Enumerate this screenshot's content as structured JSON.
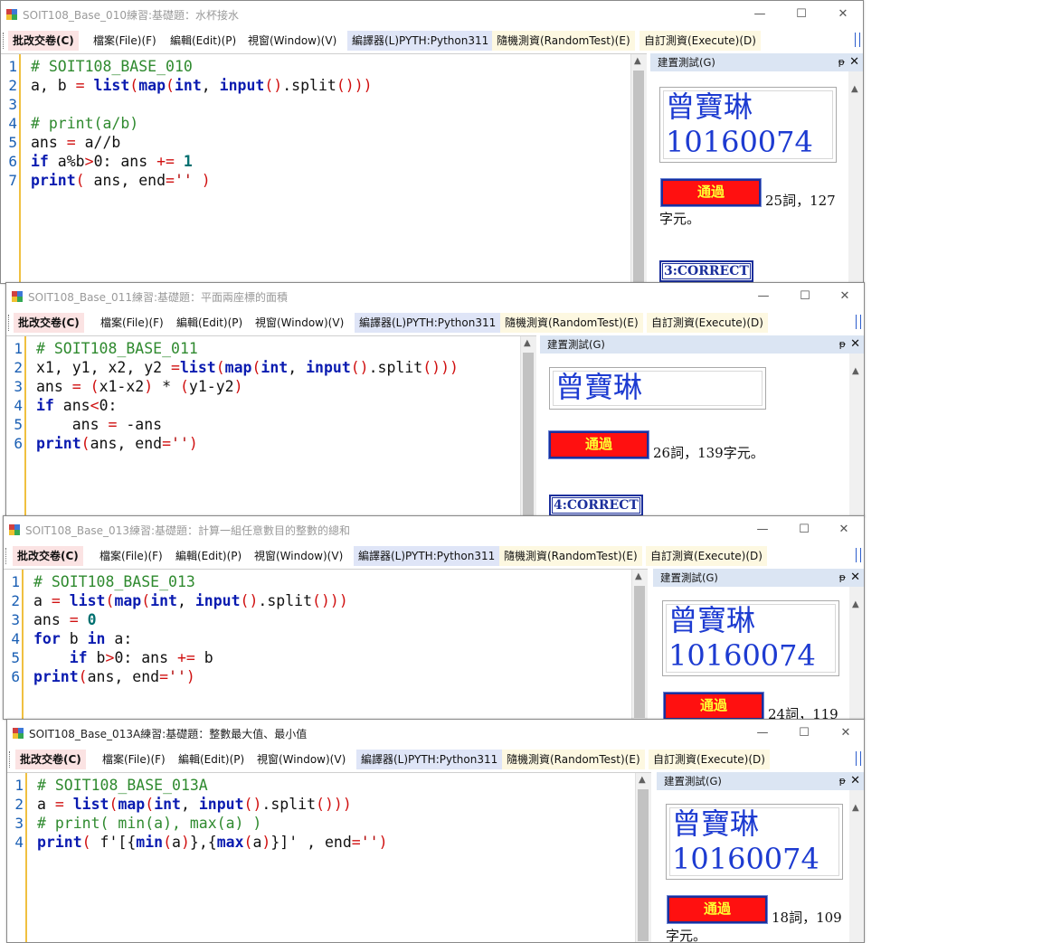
{
  "menu": {
    "submit": "批改交卷(C)",
    "file": "檔案(File)(F)",
    "edit": "編輯(Edit)(P)",
    "window": "視窗(Window)(V)",
    "interpreter": "編譯器(L)PYTH:Python311",
    "random_test": "隨機測資(RandomTest)(E)",
    "custom_test": "自訂測資(Execute)(D)"
  },
  "panel": {
    "title": "建置測試(G)",
    "pin": "ᵽ",
    "close": "✕",
    "pass_label": "通過"
  },
  "window_controls": {
    "minimize": "—",
    "maximize": "☐",
    "close": "✕"
  },
  "windows": [
    {
      "title": "SOIT108_Base_010練習:基礎題：水杯接水",
      "user": "曾寶琳",
      "user_id": "10160074",
      "stats": "25詞，127",
      "stats2": "字元。",
      "correct": "3:CORRECT",
      "line_numbers": [
        "1",
        "2",
        "3",
        "4",
        "5",
        "6",
        "7"
      ]
    },
    {
      "title": "SOIT108_Base_011練習:基礎題：平面兩座標的面積",
      "user_line": "曾寶琳10160074",
      "stats": "26詞，139字元。",
      "correct": "4:CORRECT",
      "line_numbers": [
        "1",
        "2",
        "3",
        "4",
        "5",
        "6"
      ]
    },
    {
      "title": "SOIT108_Base_013練習:基礎題：計算一組任意數目的整數的總和",
      "user": "曾寶琳",
      "user_id": "10160074",
      "stats": "24詞，119",
      "line_numbers": [
        "1",
        "2",
        "3",
        "4",
        "5",
        "6"
      ]
    },
    {
      "title": "SOIT108_Base_013A練習:基礎題：整數最大值、最小值",
      "user": "曾寶琳",
      "user_id": "10160074",
      "stats": "18詞，109",
      "stats2": "字元。",
      "line_numbers": [
        "1",
        "2",
        "3",
        "4"
      ]
    }
  ],
  "code": {
    "w1": [
      [
        [
          "cm",
          "# SOIT108_BASE_010"
        ]
      ],
      [
        [
          "",
          "a, b "
        ],
        [
          "op",
          "="
        ],
        [
          "",
          " "
        ],
        [
          "kw",
          "list"
        ],
        [
          "op",
          "("
        ],
        [
          "kw",
          "map"
        ],
        [
          "op",
          "("
        ],
        [
          "kw",
          "int"
        ],
        [
          "",
          ", "
        ],
        [
          "kw",
          "input"
        ],
        [
          "op",
          "()"
        ],
        [
          "",
          ".split"
        ],
        [
          "op",
          "()))"
        ]
      ],
      [
        [
          "",
          ""
        ]
      ],
      [
        [
          "cm",
          "# print(a/b)"
        ]
      ],
      [
        [
          "",
          "ans "
        ],
        [
          "op",
          "="
        ],
        [
          "",
          " a//b"
        ]
      ],
      [
        [
          "kw",
          "if"
        ],
        [
          "",
          " a%b"
        ],
        [
          "op",
          ">"
        ],
        [
          "",
          "0: ans "
        ],
        [
          "op",
          "+="
        ],
        [
          "",
          " "
        ],
        [
          "nm",
          "1"
        ]
      ],
      [
        [
          "kw",
          "print"
        ],
        [
          "op",
          "("
        ],
        [
          "",
          " ans, end"
        ],
        [
          "op",
          "="
        ],
        [
          "st",
          "''"
        ],
        [
          "",
          " "
        ],
        [
          "op",
          ")"
        ]
      ]
    ],
    "w2": [
      [
        [
          "cm",
          "# SOIT108_BASE_011"
        ]
      ],
      [
        [
          "",
          "x1, y1, x2, y2 "
        ],
        [
          "op",
          "="
        ],
        [
          "kw",
          "list"
        ],
        [
          "op",
          "("
        ],
        [
          "kw",
          "map"
        ],
        [
          "op",
          "("
        ],
        [
          "kw",
          "int"
        ],
        [
          "",
          ", "
        ],
        [
          "kw",
          "input"
        ],
        [
          "op",
          "()"
        ],
        [
          "",
          ".split"
        ],
        [
          "op",
          "()))"
        ]
      ],
      [
        [
          "",
          "ans "
        ],
        [
          "op",
          "="
        ],
        [
          "",
          " "
        ],
        [
          "op",
          "("
        ],
        [
          "",
          "x1-x2"
        ],
        [
          "op",
          ")"
        ],
        [
          "",
          " * "
        ],
        [
          "op",
          "("
        ],
        [
          "",
          "y1-y2"
        ],
        [
          "op",
          ")"
        ]
      ],
      [
        [
          "kw",
          "if"
        ],
        [
          "",
          " ans"
        ],
        [
          "op",
          "<"
        ],
        [
          "",
          "0:"
        ]
      ],
      [
        [
          "",
          "    ans "
        ],
        [
          "op",
          "="
        ],
        [
          "",
          " -ans"
        ]
      ],
      [
        [
          "kw",
          "print"
        ],
        [
          "op",
          "("
        ],
        [
          "",
          "ans, end"
        ],
        [
          "op",
          "="
        ],
        [
          "st",
          "''"
        ],
        [
          "op",
          ")"
        ]
      ]
    ],
    "w3": [
      [
        [
          "cm",
          "# SOIT108_BASE_013"
        ]
      ],
      [
        [
          "",
          "a "
        ],
        [
          "op",
          "="
        ],
        [
          "",
          " "
        ],
        [
          "kw",
          "list"
        ],
        [
          "op",
          "("
        ],
        [
          "kw",
          "map"
        ],
        [
          "op",
          "("
        ],
        [
          "kw",
          "int"
        ],
        [
          "",
          ", "
        ],
        [
          "kw",
          "input"
        ],
        [
          "op",
          "()"
        ],
        [
          "",
          ".split"
        ],
        [
          "op",
          "()))"
        ]
      ],
      [
        [
          "",
          "ans "
        ],
        [
          "op",
          "="
        ],
        [
          "",
          " "
        ],
        [
          "nm",
          "0"
        ]
      ],
      [
        [
          "kw",
          "for"
        ],
        [
          "",
          " b "
        ],
        [
          "kw",
          "in"
        ],
        [
          "",
          " a:"
        ]
      ],
      [
        [
          "",
          "    "
        ],
        [
          "kw",
          "if"
        ],
        [
          "",
          " b"
        ],
        [
          "op",
          ">"
        ],
        [
          "",
          "0: ans "
        ],
        [
          "op",
          "+="
        ],
        [
          "",
          " b"
        ]
      ],
      [
        [
          "kw",
          "print"
        ],
        [
          "op",
          "("
        ],
        [
          "",
          "ans, end"
        ],
        [
          "op",
          "="
        ],
        [
          "st",
          "''"
        ],
        [
          "op",
          ")"
        ]
      ]
    ],
    "w4": [
      [
        [
          "cm",
          "# SOIT108_BASE_013A"
        ]
      ],
      [
        [
          "",
          "a "
        ],
        [
          "op",
          "="
        ],
        [
          "",
          " "
        ],
        [
          "kw",
          "list"
        ],
        [
          "op",
          "("
        ],
        [
          "kw",
          "map"
        ],
        [
          "op",
          "("
        ],
        [
          "kw",
          "int"
        ],
        [
          "",
          ", "
        ],
        [
          "kw",
          "input"
        ],
        [
          "op",
          "()"
        ],
        [
          "",
          ".split"
        ],
        [
          "op",
          "()))"
        ]
      ],
      [
        [
          "cm",
          "# print( min(a), max(a) )"
        ]
      ],
      [
        [
          "kw",
          "print"
        ],
        [
          "op",
          "("
        ],
        [
          "",
          " f'[{"
        ],
        [
          "kw",
          "min"
        ],
        [
          "op",
          "("
        ],
        [
          "",
          "a"
        ],
        [
          "op",
          ")"
        ],
        [
          "",
          "},{"
        ],
        [
          "kw",
          "max"
        ],
        [
          "op",
          "("
        ],
        [
          "",
          "a"
        ],
        [
          "op",
          ")"
        ],
        [
          "",
          "}]' , end"
        ],
        [
          "op",
          "="
        ],
        [
          "st",
          "''"
        ],
        [
          "op",
          ")"
        ]
      ]
    ]
  }
}
